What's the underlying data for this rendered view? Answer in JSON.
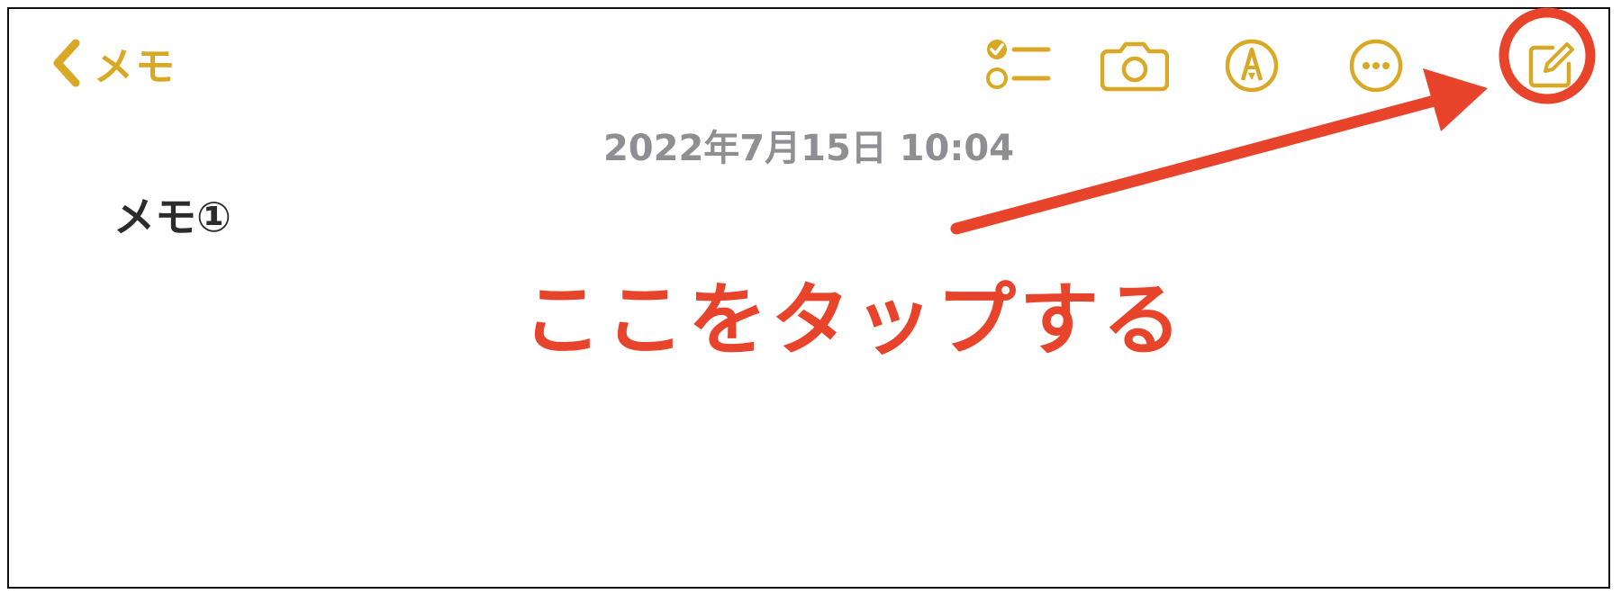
{
  "nav": {
    "back_label": "メモ",
    "back_icon": "chevron-left-icon",
    "toolbar": [
      {
        "name": "checklist-icon"
      },
      {
        "name": "camera-icon"
      },
      {
        "name": "markup-pen-icon"
      },
      {
        "name": "more-ellipsis-icon"
      },
      {
        "name": "compose-note-icon"
      }
    ]
  },
  "note": {
    "date": "2022年7月15日 10:04",
    "title": "メモ①"
  },
  "annotation": {
    "callout": "ここをタップする",
    "highlight_color": "#e8432b"
  },
  "colors": {
    "accent": "#d9a926",
    "date_gray": "#8e8e93",
    "title_text": "#2b2b2b",
    "annotation_red": "#e8432b"
  }
}
